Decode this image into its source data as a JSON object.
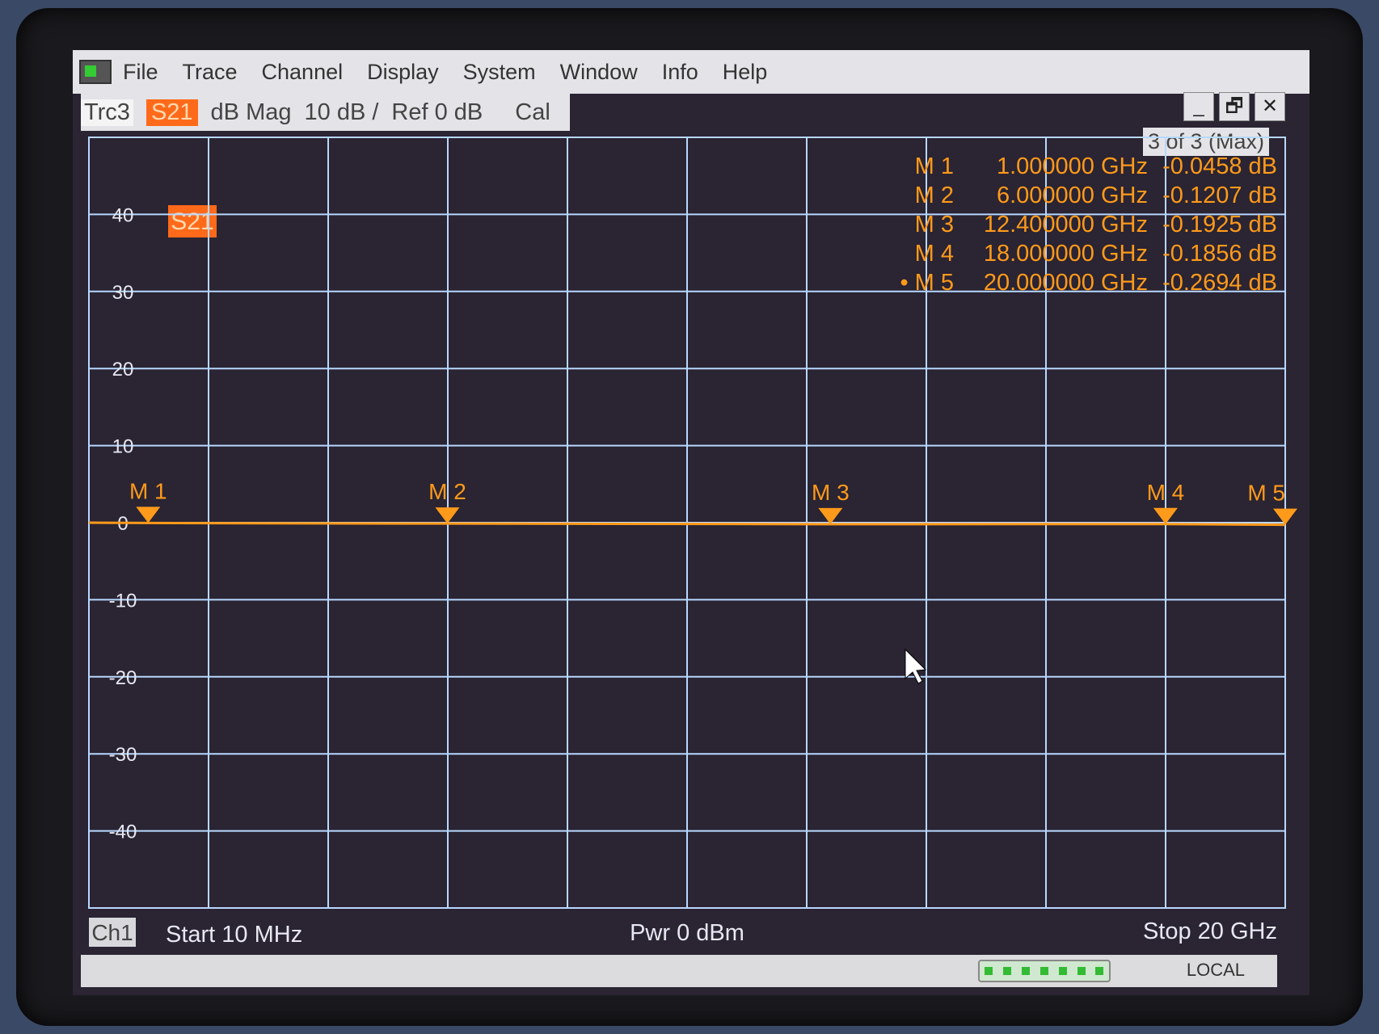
{
  "menu": {
    "items": [
      "File",
      "Trace",
      "Channel",
      "Display",
      "System",
      "Window",
      "Info",
      "Help"
    ]
  },
  "window_buttons": {
    "minimize": "_",
    "restore": "🗗",
    "close": "✕"
  },
  "trace_bar": {
    "trace": "Trc3",
    "param": "S21",
    "format": "dB Mag",
    "scale": "10 dB /",
    "ref": "Ref 0 dB",
    "cal": "Cal"
  },
  "window_count": "3 of 3 (Max)",
  "channel": {
    "label": "Ch1",
    "start": "Start  10 MHz",
    "power": "Pwr  0 dBm",
    "stop": "Stop  20 GHz"
  },
  "status": {
    "local": "LOCAL"
  },
  "colors": {
    "trace": "#ff9a1a",
    "grid": "#b8d8ff",
    "background": "#2a2433",
    "badge": "#ff6a1a"
  },
  "chart_data": {
    "type": "line",
    "title": "",
    "trace_label": "S21",
    "xlabel": "",
    "ylabel": "",
    "xlim": [
      0.01,
      20
    ],
    "x_unit": "GHz",
    "ylim": [
      -50,
      50
    ],
    "yticks": [
      40,
      30,
      20,
      10,
      0,
      -10,
      -20,
      -30,
      -40
    ],
    "ytick_labels": [
      "40",
      "30",
      "20",
      "10",
      "0",
      "-10",
      "-20",
      "-30",
      "-40"
    ],
    "grid": true,
    "x_divisions": 10,
    "series": [
      {
        "x": [
          0.01,
          1,
          6,
          12.4,
          18,
          20
        ],
        "y": [
          0,
          -0.0458,
          -0.1207,
          -0.1925,
          -0.1856,
          -0.2694
        ]
      }
    ],
    "markers": [
      {
        "label": "M 1",
        "freq": 1,
        "freq_text": "1.000000 GHz",
        "value": -0.0458,
        "value_text": "-0.0458 dB",
        "active": false
      },
      {
        "label": "M 2",
        "freq": 6,
        "freq_text": "6.000000 GHz",
        "value": -0.1207,
        "value_text": "-0.1207 dB",
        "active": false
      },
      {
        "label": "M 3",
        "freq": 12.4,
        "freq_text": "12.400000 GHz",
        "value": -0.1925,
        "value_text": "-0.1925 dB",
        "active": false
      },
      {
        "label": "M 4",
        "freq": 18,
        "freq_text": "18.000000 GHz",
        "value": -0.1856,
        "value_text": "-0.1856 dB",
        "active": false
      },
      {
        "label": "M 5",
        "freq": 20,
        "freq_text": "20.000000 GHz",
        "value": -0.2694,
        "value_text": "-0.2694 dB",
        "active": true
      }
    ],
    "legend_placement": "top-right"
  }
}
